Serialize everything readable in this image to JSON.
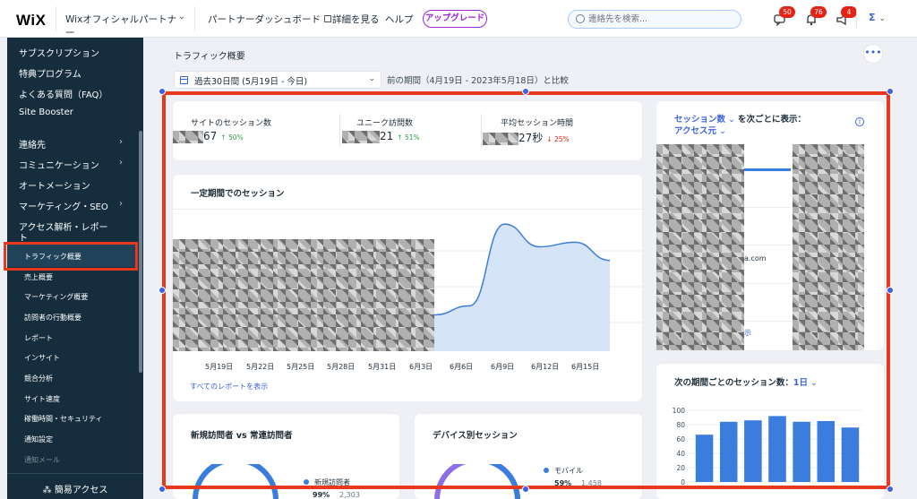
{
  "topbar": {
    "logo": "WiX",
    "site_selector": "Wixオフィシャルパートナー",
    "links": [
      {
        "label": "パートナーダッシュボード"
      },
      {
        "label": "詳細を見る"
      },
      {
        "label": "ヘルプ"
      }
    ],
    "upgrade": "アップグレード",
    "search_placeholder": "連絡先を検索...",
    "badges": {
      "messages": "50",
      "notifications": "76",
      "inbox": "4"
    },
    "user_initial": "Σ"
  },
  "sidebar": {
    "items": [
      {
        "label": "サブスクリプション",
        "arrow": ""
      },
      {
        "label": "特典プログラム",
        "arrow": ""
      },
      {
        "label": "よくある質問（FAQ）",
        "arrow": ""
      },
      {
        "label": "Site Booster",
        "arrow": ""
      },
      {
        "label": "連絡先",
        "arrow": "›"
      },
      {
        "label": "コミュニケーション",
        "arrow": "›"
      },
      {
        "label": "オートメーション",
        "arrow": ""
      },
      {
        "label": "マーケティング・SEO",
        "arrow": "›"
      },
      {
        "label": "アクセス解析・レポー",
        "arrow": ""
      },
      {
        "label": "ト",
        "arrow": ""
      }
    ],
    "subitems": [
      "トラフィック概要",
      "売上概要",
      "マーケティング概要",
      "訪問者の行動概要",
      "レポート",
      "インサイト",
      "競合分析",
      "サイト速度",
      "稼働時間・セキュリティ",
      "通知設定",
      "通知メール"
    ],
    "bottom": "簡易アクセス"
  },
  "main": {
    "title": "トラフィック概要",
    "more": "•••",
    "date_range": "過去30日間 (5月19日 - 今日)",
    "compare": "前の期間（4月19日 - 2023年5月18日）と比較",
    "stats": [
      {
        "label": "サイトのセッション数",
        "value": "67",
        "change": "↑ 50%",
        "dir": "up"
      },
      {
        "label": "ユニーク訪問数",
        "value": "21",
        "change": "↑ 51%",
        "dir": "up"
      },
      {
        "label": "平均セッション時間",
        "value": "27秒",
        "change": "↓ 25%",
        "dir": "down"
      }
    ],
    "sessions_card": {
      "title": "一定期間でのセッション",
      "link": "すべてのレポートを表示"
    },
    "breakdown": {
      "metric": "セッション数",
      "suffix": "を次ごとに表示：",
      "dimension": "アクセス元",
      "partial_text": "a.com",
      "partial_link": "示"
    },
    "period_card": {
      "title": "次の期間ごとのセッション数：",
      "period": "1日"
    },
    "new_vs_returning": {
      "title": "新規訪問者 vs 常連訪問者",
      "legend": "新規訪問者",
      "pct": "99%",
      "count": "2,303"
    },
    "device": {
      "title": "デバイス別セッション",
      "legend": "モバイル",
      "pct": "59%",
      "count": "1,458"
    }
  },
  "chart_data": [
    {
      "type": "area",
      "title": "一定期間でのセッション",
      "x": [
        "5月19日",
        "5月22日",
        "5月25日",
        "5月28日",
        "5月31日",
        "6月3日",
        "6月6日",
        "6月9日",
        "6月12日",
        "6月15日"
      ],
      "visible_series_from_index": 5,
      "series": [
        {
          "values": [
            null,
            null,
            null,
            null,
            null,
            40,
            50,
            140,
            115,
            120,
            100
          ]
        }
      ],
      "color": "#3b7ddd",
      "fill": "#d6e4f7"
    },
    {
      "type": "bar",
      "title": "次の期間ごとのセッション数：1日",
      "ylim": [
        0,
        100
      ],
      "yticks": [
        0,
        20,
        40,
        60,
        80,
        100
      ],
      "values": [
        66,
        84,
        86,
        92,
        84,
        85,
        76
      ],
      "color": "#3b7ddd"
    }
  ]
}
